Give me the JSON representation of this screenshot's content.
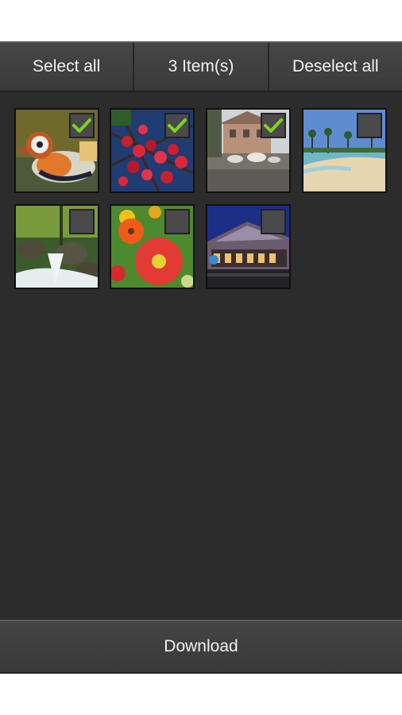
{
  "toolbar": {
    "select_all": "Select all",
    "item_count": "3 Item(s)",
    "deselect_all": "Deselect all"
  },
  "photos": [
    {
      "subject": "mandarin duck",
      "selected": true
    },
    {
      "subject": "red berries",
      "selected": true
    },
    {
      "subject": "street with cattle",
      "selected": true
    },
    {
      "subject": "tropical beach",
      "selected": false
    },
    {
      "subject": "forest waterfall",
      "selected": false
    },
    {
      "subject": "red poppies",
      "selected": false
    },
    {
      "subject": "building at night",
      "selected": false
    }
  ],
  "download_label": "Download",
  "colors": {
    "check_green": "#7ed321",
    "grid_bg": "#2c2c2c",
    "bar_bg": "#404040"
  }
}
